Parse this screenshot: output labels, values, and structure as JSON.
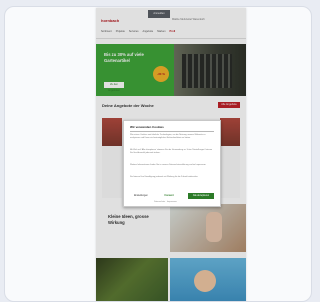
{
  "header": {
    "logo": "hornbach",
    "login_label": "Anmelden",
    "nav_links": [
      "Märkte",
      "Merkzettel",
      "Warenkorb"
    ],
    "tabs": [
      "Sortiment",
      "Projekte",
      "Services",
      "Angebote",
      "Marken",
      "Profi"
    ]
  },
  "hero": {
    "title": "Bis zu 30% auf viele Gartenartikel",
    "button_label": "Zu den Angeboten",
    "badge": "-30 %"
  },
  "section": {
    "title": "Deine Angebote der Woche",
    "button_label": "Alle Angebote"
  },
  "features": {
    "title": "Kleine Ideen, grosse Wirkung"
  },
  "cookie_modal": {
    "title": "Wir verwenden Cookies",
    "paragraphs": [
      "Wir nutzen Cookies und ähnliche Technologien, um die Nutzung unserer Webseite zu analysieren und Ihnen ein bestmögliches Einkaufserlebnis zu bieten.",
      "Mit Klick auf 'Alle akzeptieren' stimmen Sie der Verwendung zu. Unter 'Einstellungen' können Sie Ihre Auswahl jederzeit ändern.",
      "Weitere Informationen finden Sie in unserer Datenschutzerklärung und im Impressum.",
      "Sie können Ihre Einwilligung jederzeit mit Wirkung für die Zukunft widerrufen."
    ],
    "settings_label": "Einstellungen",
    "logo_label": "Consent",
    "accept_label": "Alle akzeptieren",
    "footer": "Datenschutz · Impressum"
  },
  "colors": {
    "brand": "#b5171d",
    "hero_bg": "#3fa63a",
    "accept": "#2c7b28"
  }
}
